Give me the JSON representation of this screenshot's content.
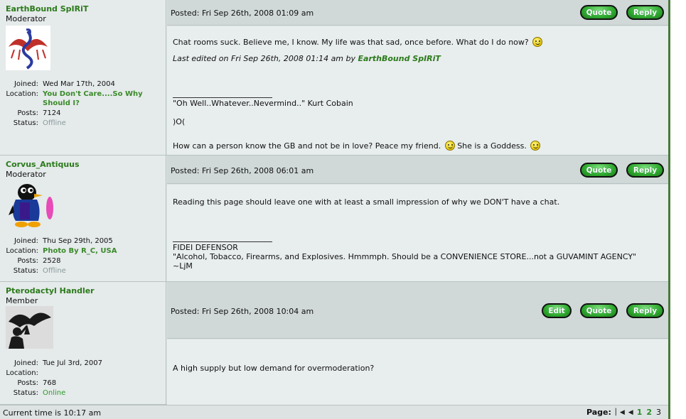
{
  "posts": [
    {
      "author": "EarthBound SpIRiT",
      "rank": "Moderator",
      "stats": {
        "joined": "Wed Mar 17th, 2004",
        "location": "You Don't Care....So Why Should I?",
        "posts": "7124",
        "status": "Offline"
      },
      "date": "Posted: Fri Sep 26th, 2008 01:09 am",
      "lines": {
        "l1": "Chat rooms suck.  Believe me, I know.  My life was that sad, once before.  What do I do now?",
        "edited_prefix": "Last edited on Fri Sep 26th, 2008 01:14 am by ",
        "edited_by": "EarthBound SpIRiT",
        "sig1": "\"Oh Well..Whatever..Nevermind..\" Kurt Cobain",
        "sig2": ")O(",
        "sig3a": "How can a person know the GB and not be in love? Peace my friend.",
        "sig3b": "She is a Goddess."
      }
    },
    {
      "author": "Corvus_Antiquus",
      "rank": "Moderator",
      "stats": {
        "joined": "Thu Sep 29th, 2005",
        "location": "Photo By R_C, USA",
        "posts": "2528",
        "status": "Offline"
      },
      "date": "Posted: Fri Sep 26th, 2008 06:01 am",
      "lines": {
        "l1": "Reading this page should leave one with at least a small impression of why we DON'T have a chat.",
        "sig1": "FIDEI DEFENSOR",
        "sig2": "\"Alcohol, Tobacco, Firearms, and Explosives. Hmmmph. Should be a CONVENIENCE STORE...not a GUVAMINT AGENCY\"",
        "sig3": "~LjM"
      }
    },
    {
      "author": "Pterodactyl Handler",
      "rank": "Member",
      "stats": {
        "joined": "Tue Jul 3rd, 2007",
        "location": "",
        "posts": "768",
        "status": "Online"
      },
      "date": "Posted: Fri Sep 26th, 2008 10:04 am",
      "lines": {
        "l1": "A high supply but low demand for overmoderation?"
      }
    }
  ],
  "labels": {
    "joined": "Joined:",
    "location": "Location:",
    "posts": "Posts:",
    "status": "Status:"
  },
  "buttons": {
    "quote": "Quote",
    "reply": "Reply",
    "edit": "Edit"
  },
  "footer": {
    "time": "Current time is 10:17 am",
    "page_label": "Page:",
    "pages": [
      "1",
      "2",
      "3"
    ],
    "current_page": "3"
  },
  "colors": {
    "username": "#2a7a1a",
    "button": "#2ea82e",
    "online": "#2a9a2a",
    "offline": "#8a9a9a"
  },
  "icons": {
    "smiley": "smiley-icon",
    "wink": "wink-smiley-icon",
    "first": "first-page-icon",
    "prev": "prev-page-icon"
  }
}
